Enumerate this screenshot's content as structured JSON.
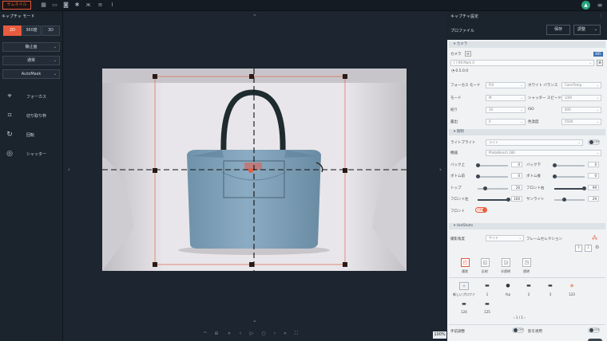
{
  "topbar": {
    "thumbnail_tab": "サムネイル",
    "icons": [
      "grid-icon",
      "image-icon",
      "camera-icon",
      "settings-icon",
      "butterfly-icon",
      "sliders-icon",
      "text-cursor-icon"
    ]
  },
  "left": {
    "title": "キャプチャ モード",
    "modes": [
      "2D",
      "360度",
      "3D"
    ],
    "selects": [
      "静止画",
      "通常",
      "AutoMask"
    ],
    "tools": [
      {
        "icon": "focus-icon",
        "label": "フォーカス"
      },
      {
        "icon": "crop-icon",
        "label": "切り取り枠"
      },
      {
        "icon": "rotate-icon",
        "label": "回転"
      },
      {
        "icon": "shutter-icon",
        "label": "シャッター"
      }
    ]
  },
  "center": {
    "zoom": "100%"
  },
  "right": {
    "title": "キャプチャ設定",
    "profile_label": "プロファイル",
    "save_label": "保存",
    "adjust_label": "調整",
    "camera": {
      "section": "カメラ",
      "camera_label": "カメラ",
      "badge": "485",
      "camera_model": "[ ] R6 Mark II",
      "iso_readout": "0.5.0.0",
      "rows": [
        {
          "label": "フォーカス モード",
          "value": "FIX",
          "label2": "ホワイト バランス",
          "value2": "ColorTemp"
        },
        {
          "label": "モード",
          "value": "M",
          "label2": "シャッター スピード",
          "value2": "1/40"
        },
        {
          "label": "絞り",
          "value": "10",
          "label2": "ISO",
          "value2": "400"
        },
        {
          "label": "露出",
          "value": "0",
          "label2": "色温度",
          "value2": "5500"
        }
      ]
    },
    "lighting": {
      "section": "照明",
      "light_label": "ライトプライト",
      "light_value": "ライト",
      "toggle_off": "OFF",
      "device_label": "機器",
      "device_value": "PhotoBench 280",
      "sliders": [
        {
          "label": "バック上",
          "value": "0",
          "label2": "バック下",
          "value2": "0"
        },
        {
          "label": "ボトム前",
          "value": "0",
          "label2": "ボトム後",
          "value2": "0"
        },
        {
          "label": "トップ",
          "value": "26",
          "label2": "フロント右",
          "value2": "99"
        },
        {
          "label": "フロント左",
          "value": "100",
          "label2": "サンライト",
          "value2": "29"
        }
      ],
      "front_label": "フロント",
      "front_toggle": "ON"
    },
    "hotshots": {
      "section": "HotShots",
      "angle_label": "撮影角度",
      "angle_value": "サイド",
      "frame_label": "フレームセレクション",
      "modes": [
        "通常",
        "反射",
        "半透明",
        "透明"
      ],
      "presets": [
        {
          "icon": "add-icon",
          "label": "新しいプロファ"
        },
        {
          "icon": "shoe-icon",
          "label": "1"
        },
        {
          "icon": "cake-icon",
          "label": "fsp"
        },
        {
          "icon": "shoe-icon",
          "label": "2"
        },
        {
          "icon": "shoe-icon",
          "label": "3"
        },
        {
          "icon": "bottle-icon",
          "label": "123"
        },
        {
          "icon": "shoe-icon",
          "label": "124"
        },
        {
          "icon": "shoe-icon",
          "label": "125"
        }
      ],
      "pager": "1 / 1",
      "bottom_left": "手前調整",
      "bottom_left_toggle": "OFF",
      "bottom_right": "影を適用",
      "bottom_right_toggle": "OFF"
    }
  },
  "colors": {
    "accent": "#e95b3f",
    "bag": "#7e9fb6",
    "bg_dark": "#1c2530"
  }
}
